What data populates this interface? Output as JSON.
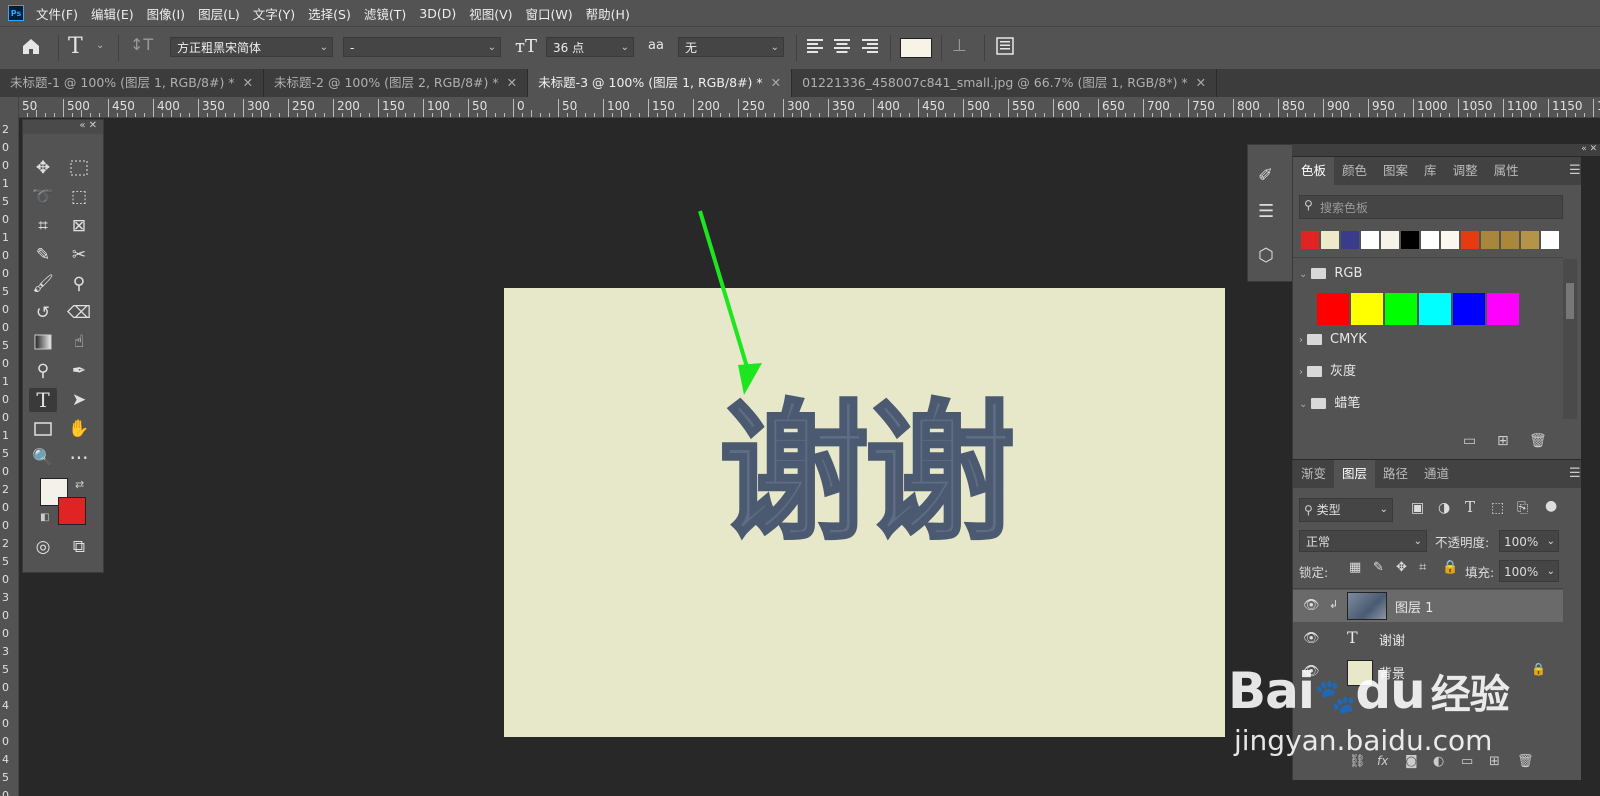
{
  "menubar": {
    "logo": "Ps",
    "items": [
      "文件(F)",
      "编辑(E)",
      "图像(I)",
      "图层(L)",
      "文字(Y)",
      "选择(S)",
      "滤镜(T)",
      "3D(D)",
      "视图(V)",
      "窗口(W)",
      "帮助(H)"
    ]
  },
  "options": {
    "font_family": "方正粗黑宋简体",
    "font_style": "-",
    "font_size": "36 点",
    "antialias_label": "aa",
    "antialias": "无",
    "text_color": "#f7f3e6"
  },
  "tabs": [
    {
      "label": "未标题-1 @ 100% (图层 1, RGB/8#) *",
      "active": false
    },
    {
      "label": "未标题-2 @ 100% (图层 2, RGB/8#) *",
      "active": false
    },
    {
      "label": "未标题-3 @ 100% (图层 1, RGB/8#) *",
      "active": true
    },
    {
      "label": "01221336_458007c841_small.jpg @ 66.7% (图层 1, RGB/8*) *",
      "active": false
    }
  ],
  "ruler": {
    "h_labels": [
      "50",
      "500",
      "450",
      "400",
      "350",
      "300",
      "250",
      "200",
      "150",
      "100",
      "50",
      "0",
      "50",
      "100",
      "150",
      "200",
      "250",
      "300",
      "350",
      "400",
      "450",
      "500",
      "550",
      "600",
      "650",
      "700",
      "750",
      "800",
      "850",
      "900",
      "950",
      "1000",
      "1050",
      "1100",
      "1150",
      "120"
    ],
    "v_labels": [
      "2",
      "0",
      "0",
      "1",
      "5",
      "0",
      "1",
      "0",
      "0",
      "5",
      "0",
      "0",
      "5",
      "0",
      "1",
      "0",
      "0",
      "1",
      "5",
      "0",
      "2",
      "0",
      "0",
      "2",
      "5",
      "0",
      "3",
      "0",
      "0",
      "3",
      "5",
      "0",
      "4",
      "0",
      "0",
      "4",
      "5",
      "0"
    ]
  },
  "canvas": {
    "text": "谢谢",
    "bg_color": "#e7e7c9",
    "text_color": "#5e6d83",
    "arrow_color": "#1ee61e"
  },
  "colors": {
    "foreground": "#f4f1ea",
    "background": "#e02323"
  },
  "swatch_panel": {
    "tabs": [
      "色板",
      "颜色",
      "图案",
      "库",
      "调整",
      "属性"
    ],
    "search_placeholder": "搜索色板",
    "recent": [
      "#e02323",
      "#eeeac9",
      "#3b3b8c",
      "#ffffff",
      "#f6f2e8",
      "#000000",
      "#ffffff",
      "#fbf7ee",
      "#e63b10",
      "#a8873c",
      "#a9883b",
      "#b49446",
      "#ffffff"
    ],
    "groups": [
      {
        "name": "RGB",
        "open": true
      },
      {
        "name": "CMYK",
        "open": false
      },
      {
        "name": "灰度",
        "open": false
      },
      {
        "name": "蜡笔",
        "open": true
      }
    ],
    "rgb_colors": [
      "#ff0000",
      "#ffff00",
      "#00ff00",
      "#00ffff",
      "#0000ff",
      "#ff00ff"
    ]
  },
  "layers_panel": {
    "tabs": [
      "渐变",
      "图层",
      "路径",
      "通道"
    ],
    "filter_label": "类型",
    "blend_mode": "正常",
    "opacity_label": "不透明度:",
    "opacity": "100%",
    "lock_label": "锁定:",
    "fill_label": "填充:",
    "fill": "100%",
    "layers": [
      {
        "name": "图层 1",
        "type": "image",
        "selected": true
      },
      {
        "name": "谢谢",
        "type": "text",
        "selected": false
      },
      {
        "name": "背景",
        "type": "background",
        "selected": false
      }
    ]
  },
  "watermark": {
    "brand": "Bai",
    "brand2": "du",
    "brand3": "经验",
    "url": "jingyan.baidu.com"
  }
}
